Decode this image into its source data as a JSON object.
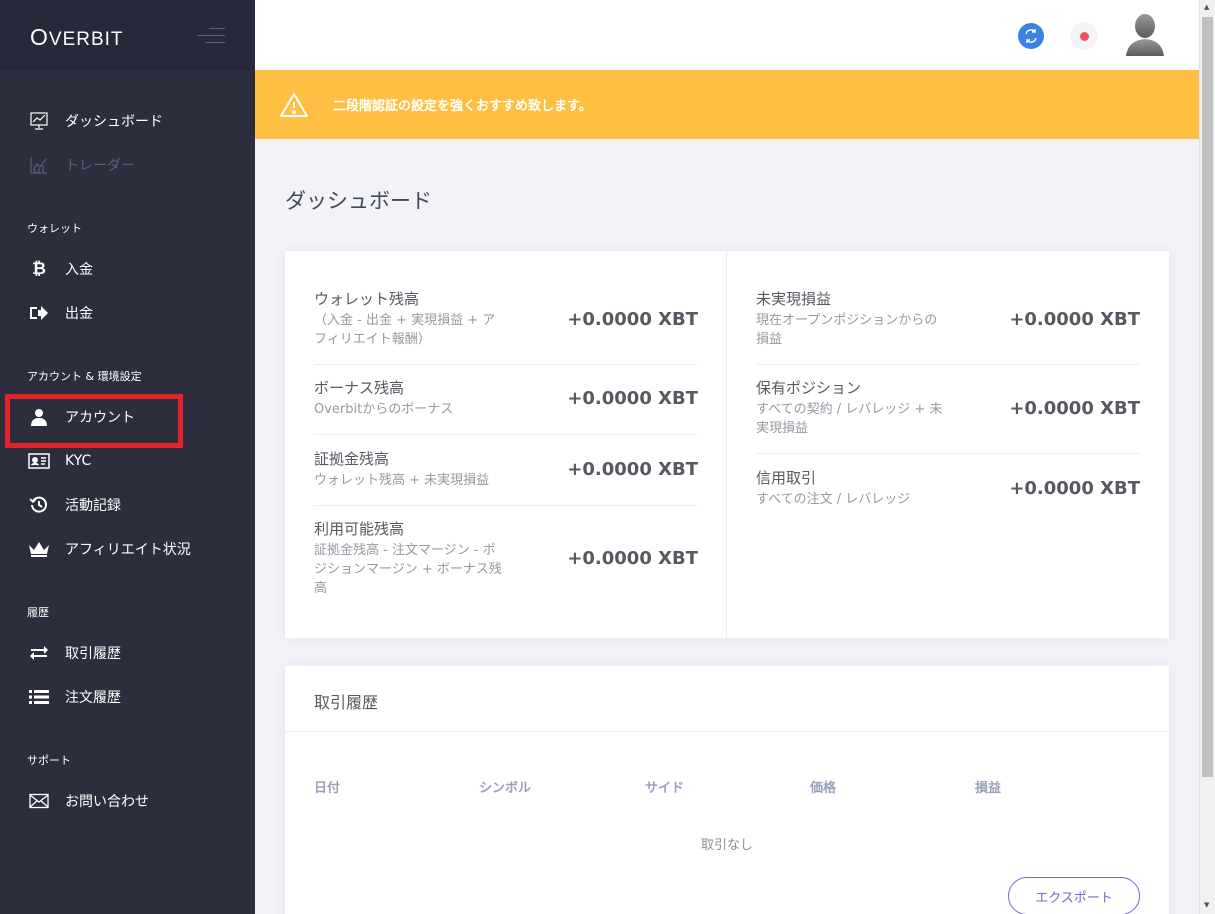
{
  "app": {
    "logo_first": "O",
    "logo_rest": "VERBIT"
  },
  "sidebar": {
    "sections": {
      "wallet": "ウォレット",
      "account": "アカウント & 環境設定",
      "history": "履歴",
      "support": "サポート"
    },
    "items": {
      "dashboard": "ダッシュボード",
      "trader": "トレーダー",
      "deposit": "入金",
      "withdraw": "出金",
      "account": "アカウント",
      "kyc": "KYC",
      "activity": "活動記録",
      "affiliate": "アフィリエイト状況",
      "trade_history": "取引履歴",
      "order_history": "注文履歴",
      "contact": "お問い合わせ"
    }
  },
  "alert": {
    "message": "二段階認証の設定を強くおすすめ致します。"
  },
  "page": {
    "title": "ダッシュボード"
  },
  "stats": {
    "wallet_balance": {
      "label": "ウォレット残高",
      "desc": "（入金 - 出金 + 実現損益 + アフィリエイト報酬）",
      "value": "+0.0000 XBT"
    },
    "bonus_balance": {
      "label": "ボーナス残高",
      "desc": "Overbitからのボーナス",
      "value": "+0.0000 XBT"
    },
    "margin_balance": {
      "label": "証拠金残高",
      "desc": "ウォレット残高 + 未実現損益",
      "value": "+0.0000 XBT"
    },
    "available_balance": {
      "label": "利用可能残高",
      "desc": "証拠金残高 - 注文マージン - ポジションマージン + ボーナス残高",
      "value": "+0.0000 XBT"
    },
    "unrealized_pnl": {
      "label": "未実現損益",
      "desc": "現在オープンポジションからの損益",
      "value": "+0.0000 XBT"
    },
    "position": {
      "label": "保有ポジション",
      "desc": "すべての契約 / レバレッジ + 未実現損益",
      "value": "+0.0000 XBT"
    },
    "margin_trading": {
      "label": "信用取引",
      "desc": "すべての注文 / レバレッジ",
      "value": "+0.0000 XBT"
    }
  },
  "trade_history": {
    "title": "取引履歴",
    "columns": [
      "日付",
      "シンボル",
      "サイド",
      "価格",
      "損益"
    ],
    "empty": "取引なし",
    "export_label": "エクスポート"
  },
  "colors": {
    "sidebar": "#2c2e3e",
    "alert": "#ffbf43",
    "accent": "#716aca",
    "highlight": "#e3222a"
  }
}
